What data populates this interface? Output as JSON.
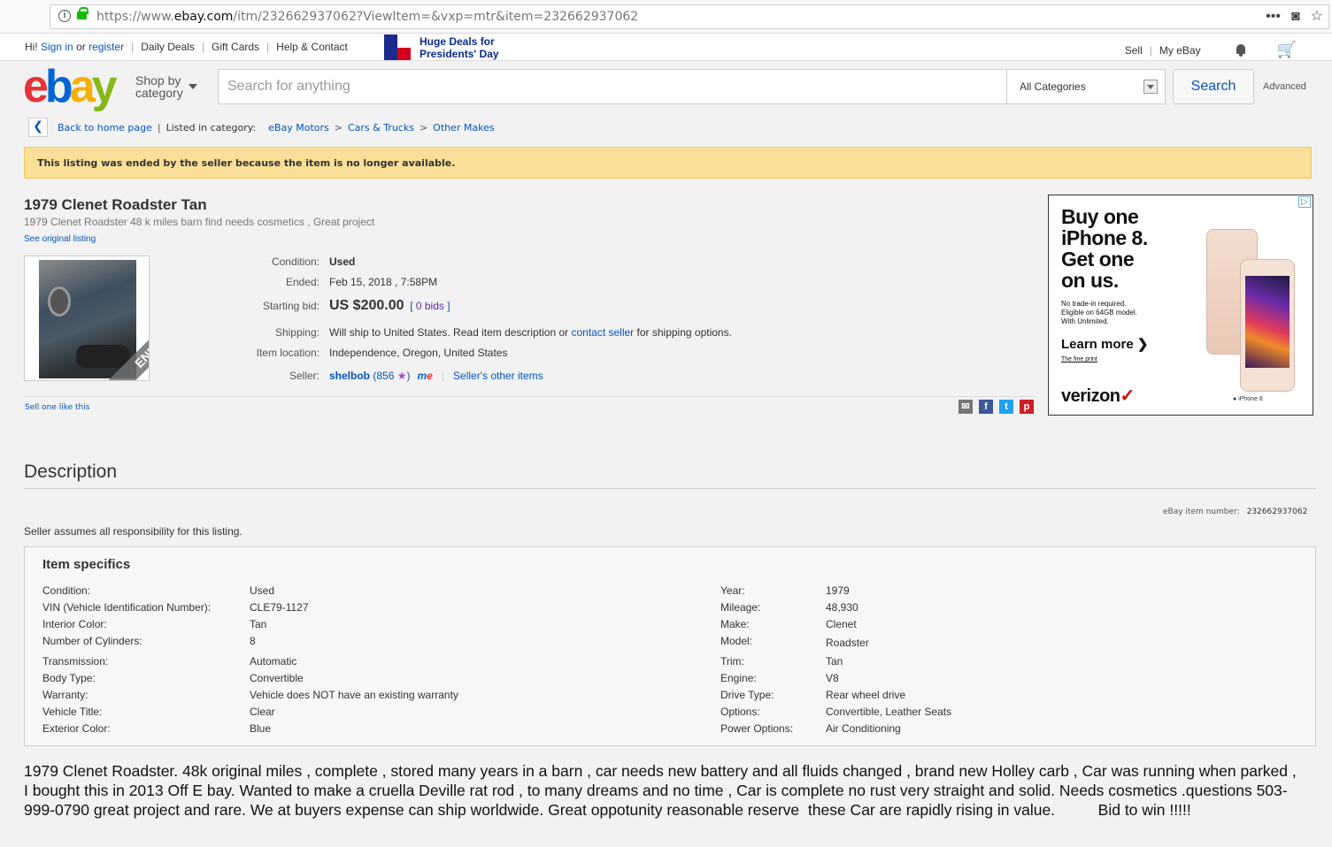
{
  "browser": {
    "url_prefix": "https://www.",
    "url_domain": "ebay.com",
    "url_rest": "/itm/232662937062?ViewItem=&vxp=mtr&item=232662937062",
    "menu_glyph": "•••",
    "pocket_glyph": "◙",
    "bookmark_glyph": "☆"
  },
  "topnav": {
    "greeting": "Hi!",
    "sign_in": "Sign in",
    "or": "or",
    "register": "register",
    "daily_deals": "Daily Deals",
    "gift_cards": "Gift Cards",
    "help": "Help & Contact",
    "promo_line1": "Huge Deals for",
    "promo_line2": "Presidents' Day",
    "sell": "Sell",
    "my_ebay": "My eBay"
  },
  "header": {
    "logo": [
      "e",
      "b",
      "a",
      "y"
    ],
    "shop_by_1": "Shop by",
    "shop_by_2": "category",
    "search_placeholder": "Search for anything",
    "category": "All Categories",
    "search_button": "Search",
    "advanced": "Advanced"
  },
  "breadcrumb": {
    "back_glyph": "❮",
    "back": "Back to home page",
    "listed": "Listed in category:",
    "items": [
      "eBay Motors",
      "Cars & Trucks",
      "Other Makes"
    ],
    "sep": ">"
  },
  "banner": "This listing was ended by the seller because the item is no longer available.",
  "item": {
    "title": "1979 Clenet Roadster Tan",
    "subtitle": "1979 Clenet Roadster 48 k miles barn find needs cosmetics , Great project",
    "see_original": "See original listing",
    "ended_badge": "ENDED",
    "condition_label": "Condition:",
    "condition": "Used",
    "ended_label": "Ended:",
    "ended": "Feb 15, 2018 , 7:58PM",
    "starting_bid_label": "Starting bid:",
    "starting_bid": "US $200.00",
    "bids_open": "[",
    "bids": "0 bids",
    "bids_close": "]",
    "shipping_label": "Shipping:",
    "shipping_pre": "Will ship to United States. Read item description or",
    "contact_seller": "contact seller",
    "shipping_post": "for shipping options.",
    "location_label": "Item location:",
    "location": "Independence, Oregon, United States",
    "seller_label": "Seller:",
    "seller_name": "shelbob",
    "seller_score_open": "(856",
    "seller_star": "★",
    "seller_score_close": ")",
    "me_badge_m": "m",
    "me_badge_e": "e",
    "seller_sep": "|",
    "seller_other": "Seller's other items",
    "sell_one": "Sell one like this"
  },
  "shares": [
    {
      "name": "email-share-icon",
      "glyph": "✉",
      "color": "#767676"
    },
    {
      "name": "facebook-share-icon",
      "glyph": "f",
      "color": "#3b5998"
    },
    {
      "name": "twitter-share-icon",
      "glyph": "t",
      "color": "#1da1f2"
    },
    {
      "name": "pinterest-share-icon",
      "glyph": "p",
      "color": "#cb2027"
    }
  ],
  "ad": {
    "adchoices": "▷",
    "headline_1": "Buy one",
    "headline_2": "iPhone 8.",
    "headline_3": "Get one",
    "headline_4": "on us.",
    "fine_1": "No trade-in required.",
    "fine_2": "Eligible on 64GB model.",
    "fine_3": "With Unlimited.",
    "learn_more": "Learn more",
    "learn_more_arrow": "❯",
    "fine_print": "The fine print",
    "brand": "verizon",
    "brand_mark": "✓",
    "phone_label": " iPhone 8"
  },
  "description": {
    "heading": "Description",
    "item_number_label": "eBay item number:",
    "item_number": "232662937062",
    "responsibility": "Seller assumes all responsibility for this listing.",
    "specifics_heading": "Item specifics",
    "left_specs": [
      {
        "label": "Condition:",
        "value": "Used"
      },
      {
        "label": "VIN (Vehicle Identification Number):",
        "value": "CLE79-1127"
      },
      {
        "label": "Interior Color:",
        "value": "Tan"
      },
      {
        "label": "Number of Cylinders:",
        "value": "8"
      },
      {
        "label": "Transmission:",
        "value": "Automatic"
      },
      {
        "label": "Body Type:",
        "value": "Convertible"
      },
      {
        "label": "Warranty:",
        "value": "Vehicle does NOT have an existing warranty"
      },
      {
        "label": "Vehicle Title:",
        "value": "Clear"
      },
      {
        "label": "Exterior Color:",
        "value": "Blue"
      }
    ],
    "right_specs": [
      {
        "label": "Year:",
        "value": "1979"
      },
      {
        "label": "Mileage:",
        "value": "48,930"
      },
      {
        "label": "Make:",
        "value": "Clenet"
      },
      {
        "label": "Model:",
        "value": "Roadster"
      },
      {
        "label": "Trim:",
        "value": "Tan"
      },
      {
        "label": "Engine:",
        "value": "V8"
      },
      {
        "label": "Drive Type:",
        "value": "Rear wheel drive"
      },
      {
        "label": "Options:",
        "value": "Convertible, Leather Seats"
      },
      {
        "label": "Power Options:",
        "value": "Air Conditioning"
      }
    ],
    "body": "1979 Clenet Roadster. 48k original miles , complete , stored many years in a barn , car needs new battery and all fluids changed , brand new Holley carb , Car was running when parked , I bought this in 2013 Off E bay. Wanted to make a cruella Deville rat rod , to many dreams and no time , Car is complete no rust very straight and solid. Needs cosmetics .questions 503-999-0790 great project and rare. We at buyers expense can ship worldwide. Great oppotunity reasonable reserve  these Car are rapidly rising in value.          Bid to win !!!!!"
  }
}
